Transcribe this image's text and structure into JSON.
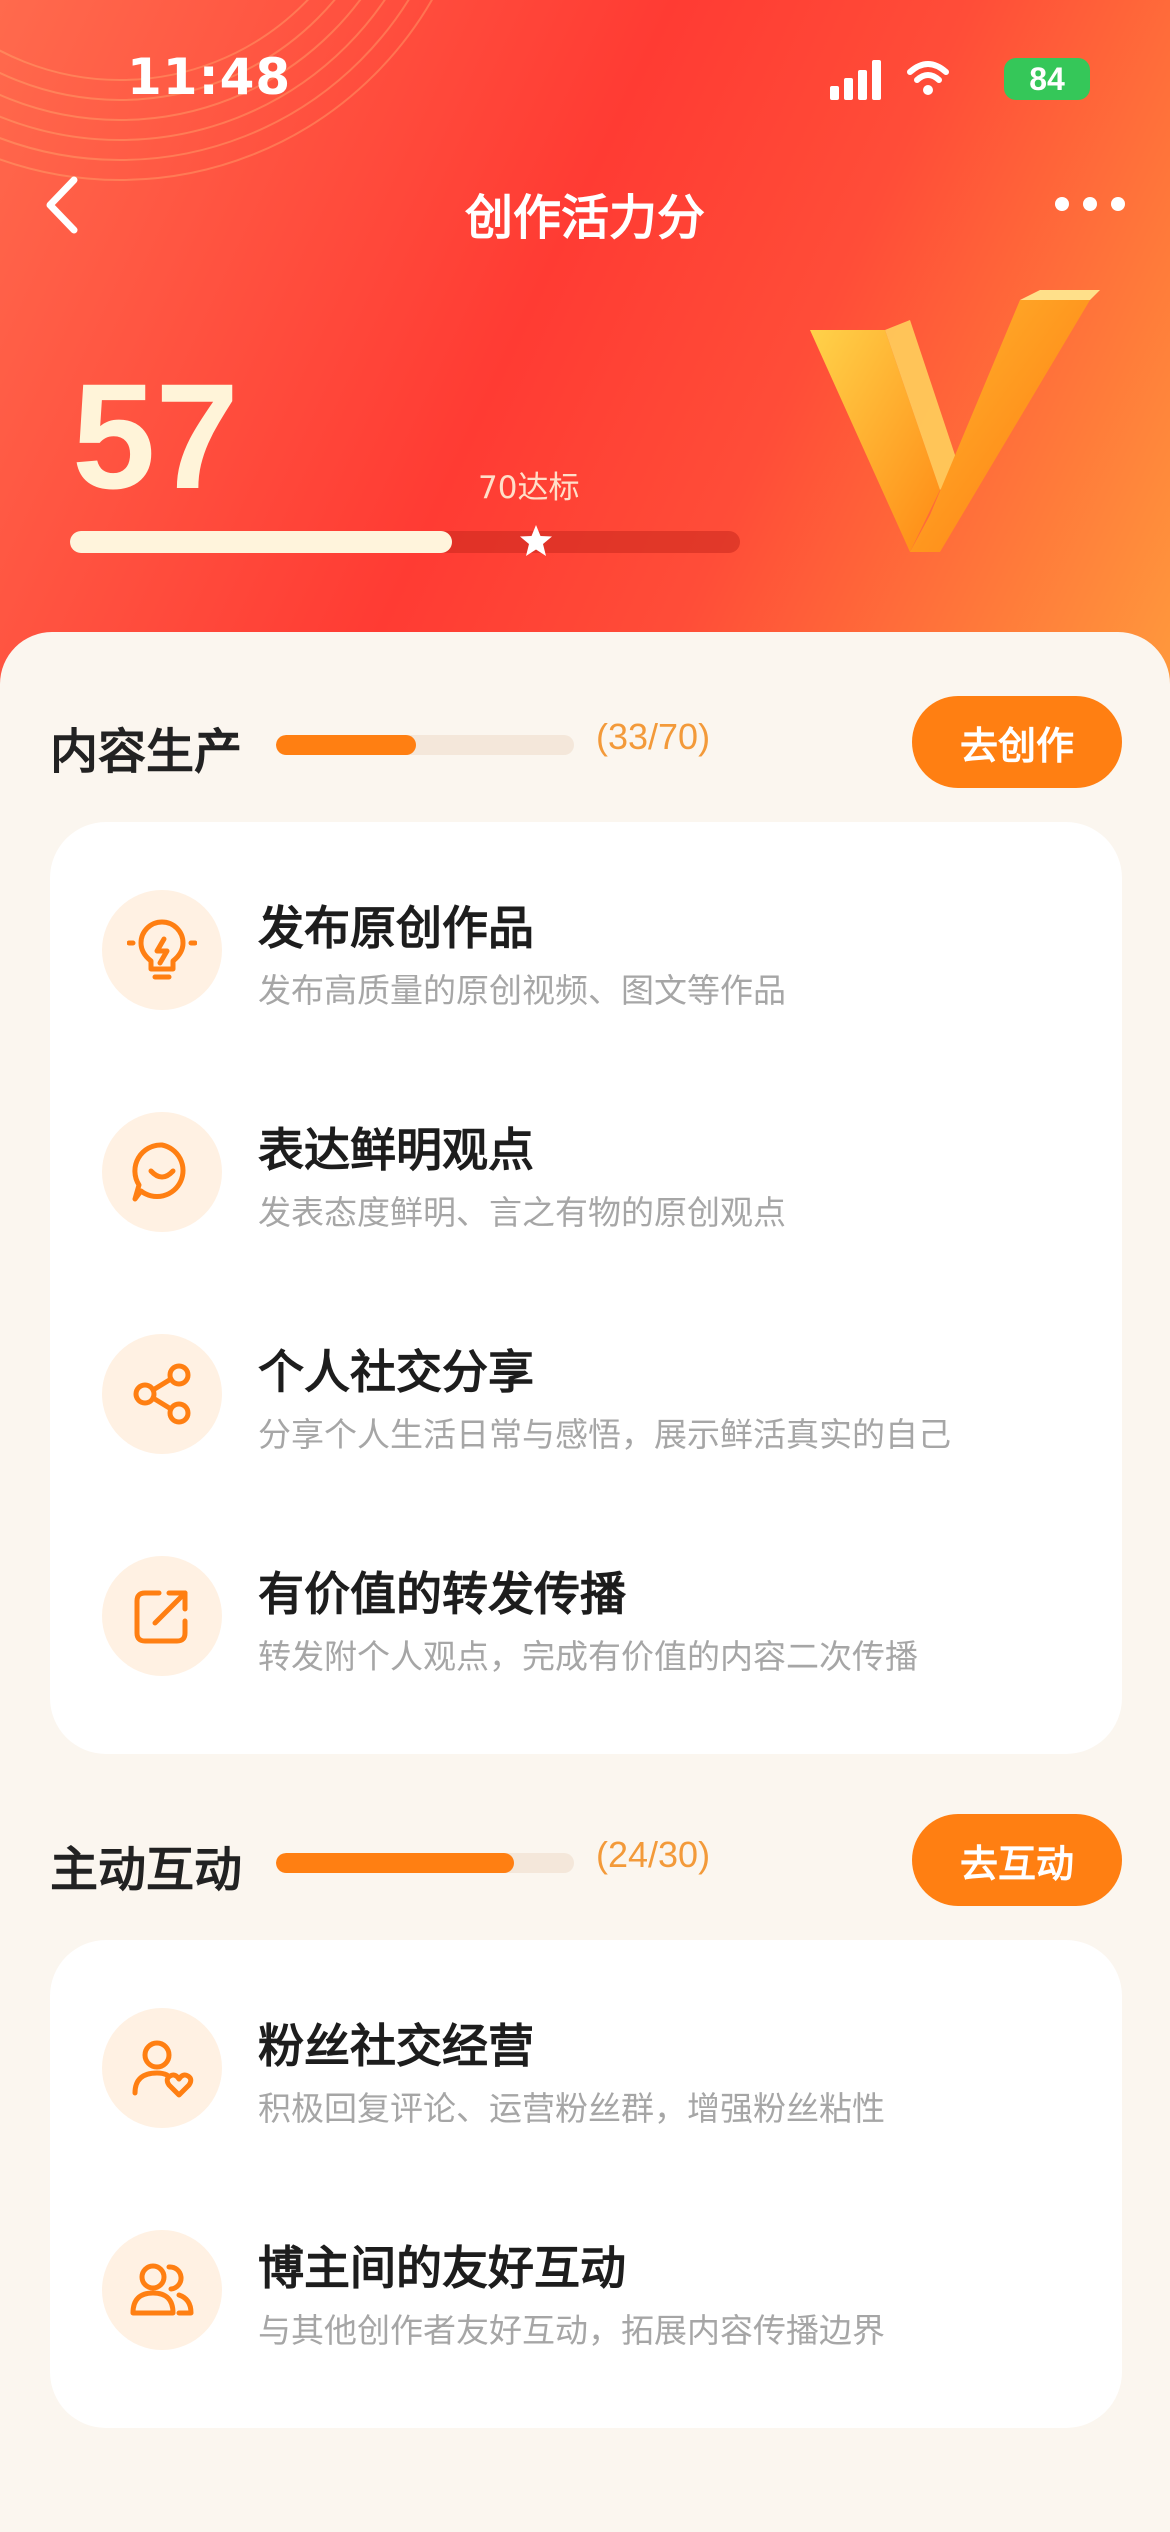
{
  "status_bar": {
    "time": "11:48",
    "battery": "84"
  },
  "nav": {
    "title": "创作活力分"
  },
  "score": {
    "value": "57",
    "target_label": "70达标",
    "progress": 0.57
  },
  "sections": [
    {
      "title": "内容生产",
      "count": "(33/70)",
      "progress": 0.47,
      "button": "去创作",
      "tasks": [
        {
          "title": "发布原创作品",
          "desc": "发布高质量的原创视频、图文等作品",
          "icon": "lightbulb-icon"
        },
        {
          "title": "表达鲜明观点",
          "desc": "发表态度鲜明、言之有物的原创观点",
          "icon": "chat-smile-icon"
        },
        {
          "title": "个人社交分享",
          "desc": "分享个人生活日常与感悟，展示鲜活真实的自己",
          "icon": "share-icon"
        },
        {
          "title": "有价值的转发传播",
          "desc": "转发附个人观点，完成有价值的内容二次传播",
          "icon": "forward-icon"
        }
      ]
    },
    {
      "title": "主动互动",
      "count": "(24/30)",
      "progress": 0.8,
      "button": "去互动",
      "tasks": [
        {
          "title": "粉丝社交经营",
          "desc": "积极回复评论、运营粉丝群，增强粉丝粘性",
          "icon": "user-heart-icon"
        },
        {
          "title": "博主间的友好互动",
          "desc": "与其他创作者友好互动，拓展内容传播边界",
          "icon": "users-icon"
        }
      ]
    }
  ],
  "colors": {
    "accent": "#ff7f12",
    "header_red": "#ff3b33",
    "score_text": "#fff4d9"
  }
}
